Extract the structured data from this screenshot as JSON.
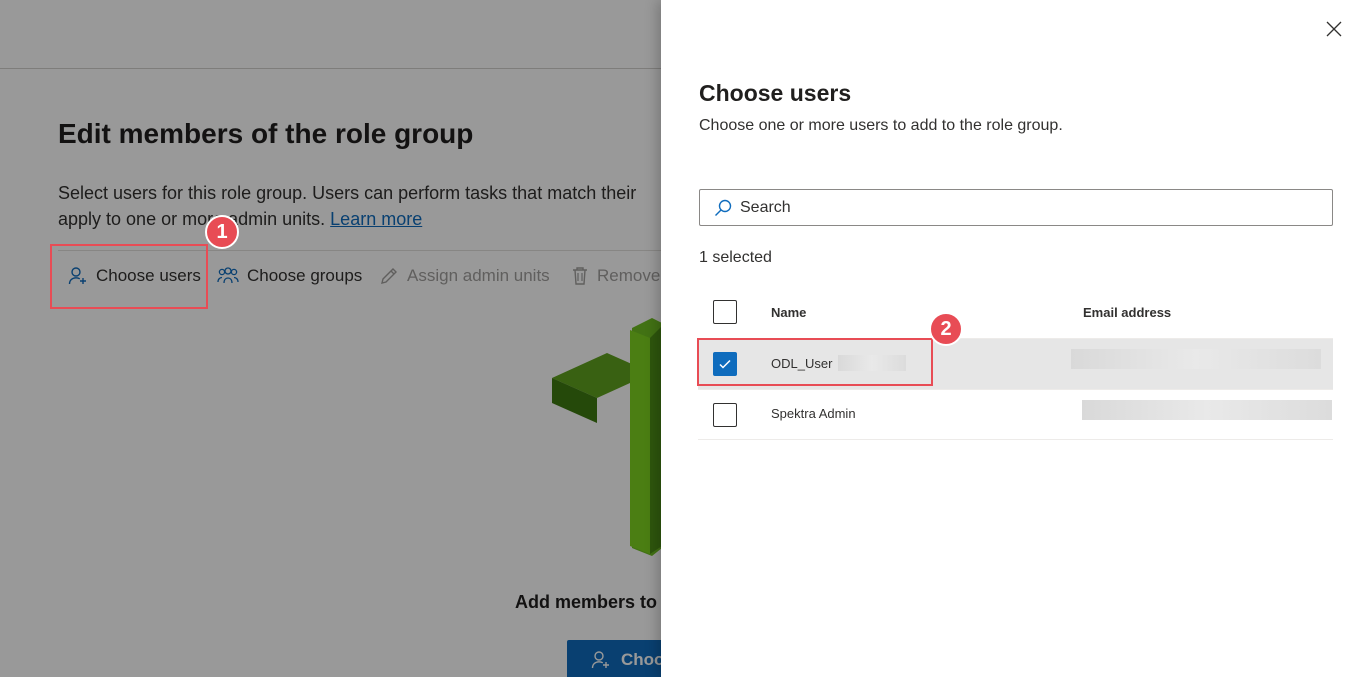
{
  "background": {
    "title": "Edit members of the role group",
    "description_line1": "Select users for this role group. Users can perform tasks that match their",
    "description_line2": "apply to one or more admin units.",
    "learn_more": "Learn more",
    "toolbar": {
      "choose_users": "Choose users",
      "choose_groups": "Choose groups",
      "assign_admin_units": "Assign admin units",
      "remove": "Remove"
    },
    "empty_state_title": "Add members to",
    "primary_button_label": "Choose"
  },
  "callouts": [
    "1",
    "2"
  ],
  "panel": {
    "title": "Choose users",
    "subtitle": "Choose one or more users to add to the role group.",
    "search_placeholder": "Search",
    "selected_count": "1 selected",
    "columns": {
      "name": "Name",
      "email": "Email address"
    },
    "rows": [
      {
        "name": "ODL_User",
        "checked": true
      },
      {
        "name": "Spektra Admin",
        "checked": false
      }
    ]
  },
  "colors": {
    "accent": "#0f6cbd",
    "callout": "#e84c55",
    "selected_row": "#e6e6e6"
  }
}
